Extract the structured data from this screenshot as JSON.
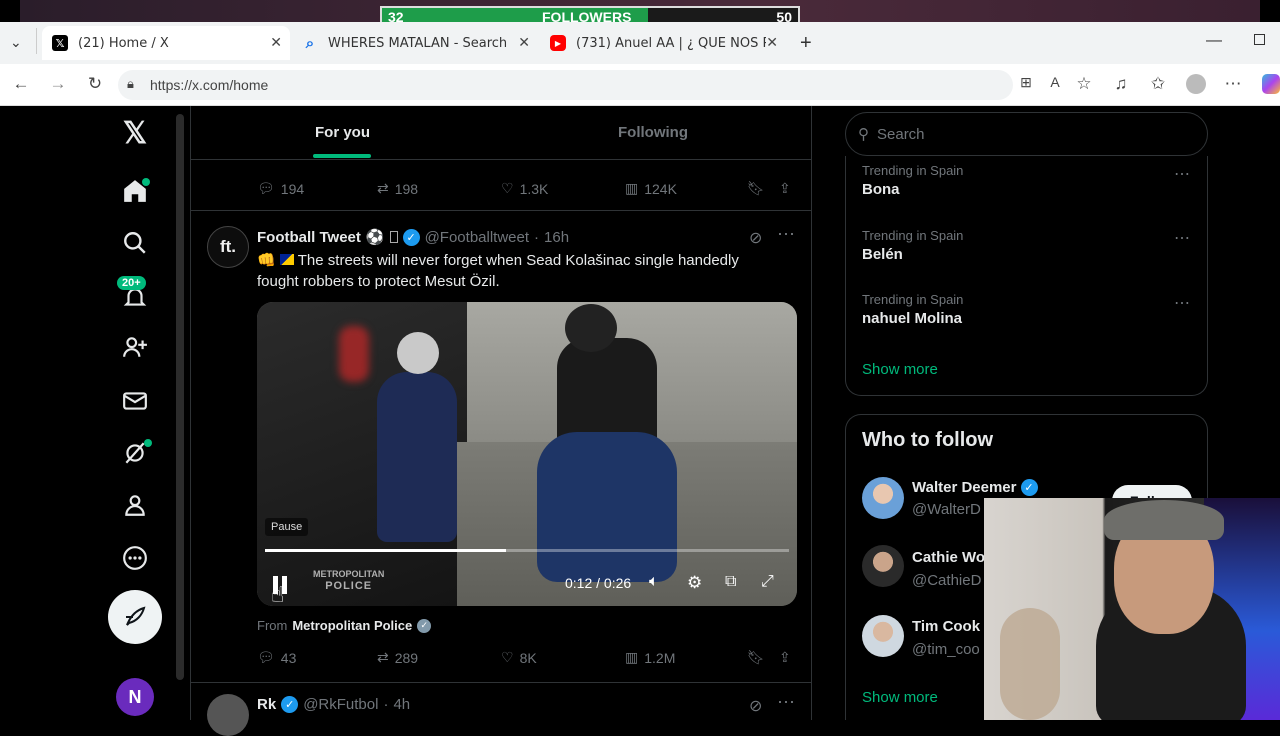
{
  "overlay": {
    "followers_label": "FOLLOWERS",
    "current": "32",
    "goal": "50",
    "progress": 0.64
  },
  "browser": {
    "tabs": [
      {
        "title": "(21) Home / X",
        "icon": "x-logo-icon"
      },
      {
        "title": "WHERES MATALAN - Search",
        "icon": "search-icon"
      },
      {
        "title": "(731) Anuel AA | ¿ QUE NOS PASO",
        "icon": "youtube-icon"
      }
    ],
    "url": "https://x.com/home"
  },
  "sidebar": {
    "notifications_badge": "20+",
    "profile_initial": "N"
  },
  "timeline": {
    "tabs": [
      "For you",
      "Following"
    ],
    "prev_post_actions": {
      "replies": "194",
      "reposts": "198",
      "likes": "1.3K",
      "views": "124K"
    },
    "post": {
      "author": "Football Tweet",
      "handle": "@Footballtweet",
      "time": "16h",
      "avatar_text": "ft.",
      "text": "The streets will never forget when Sead Kolašinac single handedly fought robbers to protect Mesut Özil.",
      "video": {
        "pause_tooltip": "Pause",
        "time": "0:12 / 0:26",
        "progress": 0.46,
        "watermark_line1": "METROPOLITAN",
        "watermark_line2": "POLICE"
      },
      "source_prefix": "From",
      "source_name": "Metropolitan Police",
      "actions": {
        "replies": "43",
        "reposts": "289",
        "likes": "8K",
        "views": "1.2M"
      }
    },
    "next_post": {
      "author": "Rk",
      "handle": "@RkFutbol",
      "time": "4h"
    }
  },
  "right": {
    "search_placeholder": "Search",
    "trends": [
      {
        "meta": "Trending in Spain",
        "name": "Bona"
      },
      {
        "meta": "Trending in Spain",
        "name": "Belén"
      },
      {
        "meta": "Trending in Spain",
        "name": "nahuel Molina"
      }
    ],
    "show_more": "Show more",
    "who_to_follow_title": "Who to follow",
    "who_to_follow": [
      {
        "name": "Walter Deemer",
        "handle": "@WalterD"
      },
      {
        "name": "Cathie Wo",
        "handle": "@CathieD"
      },
      {
        "name": "Tim Cook",
        "handle": "@tim_coo"
      }
    ],
    "follow_label": "Follow",
    "show_more_2": "Show more"
  },
  "colors": {
    "accent": "#1d9bf0",
    "green": "#00ba7c",
    "verified": "#1d9bf0"
  }
}
